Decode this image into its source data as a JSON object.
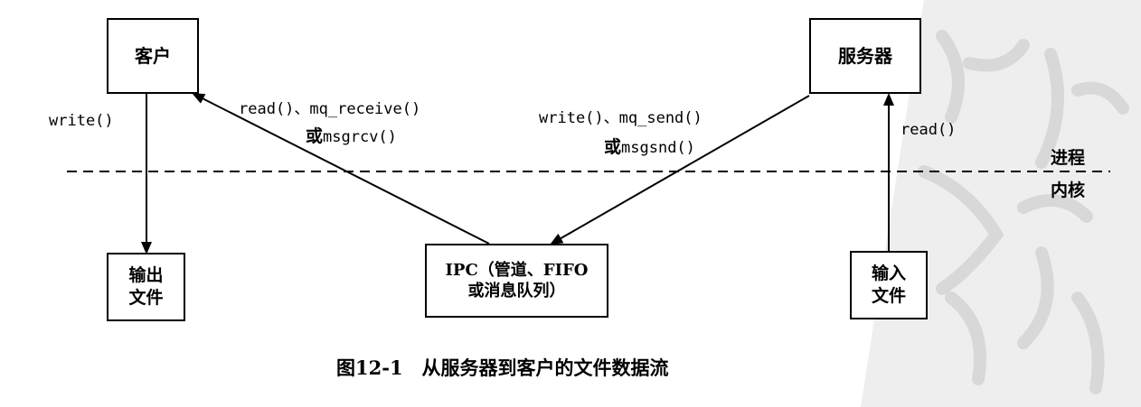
{
  "boxes": {
    "client": "客户",
    "server": "服务器",
    "output_file": [
      "输出",
      "文件"
    ],
    "input_file": [
      "输入",
      "文件"
    ],
    "ipc": [
      "IPC（管道、FIFO",
      "或消息队列）"
    ]
  },
  "labels": {
    "client_write": "write()",
    "client_read_line1": "read()、mq_receive()",
    "client_read_or": "或",
    "client_read_line2": "msgrcv()",
    "server_write_line1": "write()、mq_send()",
    "server_write_or": "或",
    "server_write_line2": "msgsnd()",
    "server_read": "read()",
    "process": "进程",
    "kernel": "内核"
  },
  "caption": "图12-1　从服务器到客户的文件数据流"
}
